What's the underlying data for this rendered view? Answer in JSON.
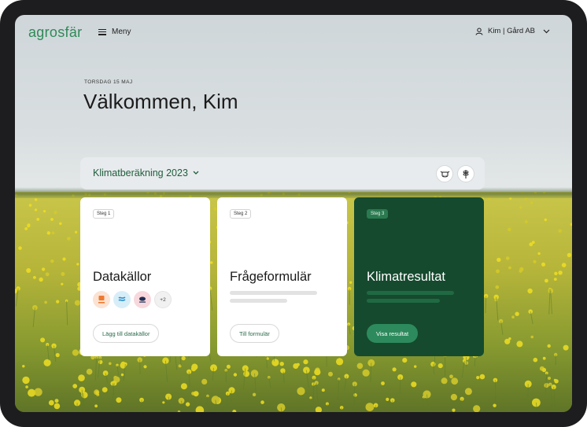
{
  "header": {
    "logo": "agrosfär",
    "menu_label": "Meny",
    "user_label": "Kim | Gård AB"
  },
  "hero": {
    "date": "TORSDAG 15 MAJ",
    "greeting": "Välkommen, Kim"
  },
  "selector": {
    "label": "Klimatberäkning 2023",
    "icons": [
      "cow-icon",
      "wheat-icon"
    ]
  },
  "cards": [
    {
      "step": "Steg 1",
      "title": "Datakällor",
      "sources": [
        "Växa",
        "Vattenkraft",
        "Sean Dernier"
      ],
      "more": "+2",
      "button": "Lägg till datakällor"
    },
    {
      "step": "Steg 2",
      "title": "Frågeformulär",
      "button": "Till formulär"
    },
    {
      "step": "Steg 3",
      "title": "Klimatresultat",
      "button": "Visa resultat"
    }
  ],
  "colors": {
    "brand": "#2f8a58",
    "dark_card": "#154a2e",
    "button_green": "#2d8a5c"
  }
}
